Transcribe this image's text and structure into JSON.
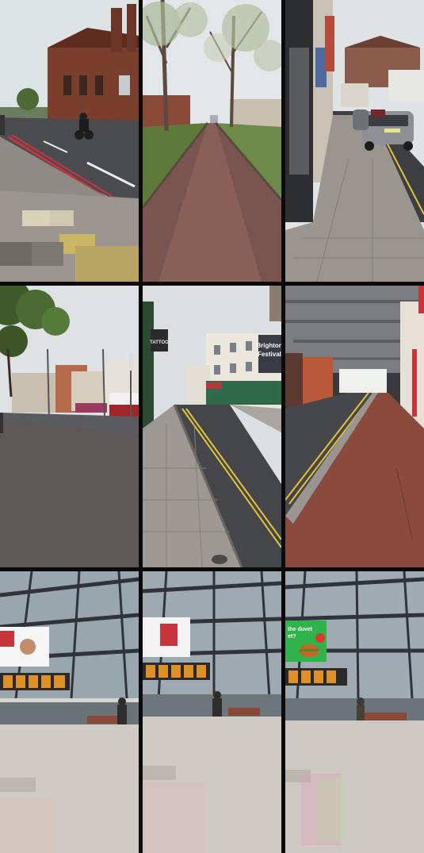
{
  "grid": {
    "rows": 3,
    "cols": 3
  },
  "photos": [
    {
      "scene": "street-church-motorbike"
    },
    {
      "scene": "tree-lined-footpath"
    },
    {
      "scene": "pavement-church-cars"
    },
    {
      "scene": "wide-street-bus"
    },
    {
      "scene": "street-shops-brighton-festival"
    },
    {
      "scene": "railway-bridge-underpass"
    },
    {
      "scene": "station-concourse-screen-a"
    },
    {
      "scene": "station-concourse-screen-b"
    },
    {
      "scene": "station-concourse-screen-burger"
    }
  ],
  "signs": {
    "tattoo": "TATTOO",
    "festival_line1": "Brighton",
    "festival_line2": "Festival",
    "ad_line1": "the duvet",
    "ad_line2": "et?"
  },
  "colors": {
    "sky": "#dfe3e6",
    "road": "#4a4b4f",
    "paving": "#9a958f",
    "brick": "#7a3e2c",
    "foliage": "#5d7a3a",
    "station_floor": "#cfcac4",
    "screen_green": "#2fb34a",
    "yellow_line": "#e0c33a",
    "red_line": "#c8343c"
  }
}
